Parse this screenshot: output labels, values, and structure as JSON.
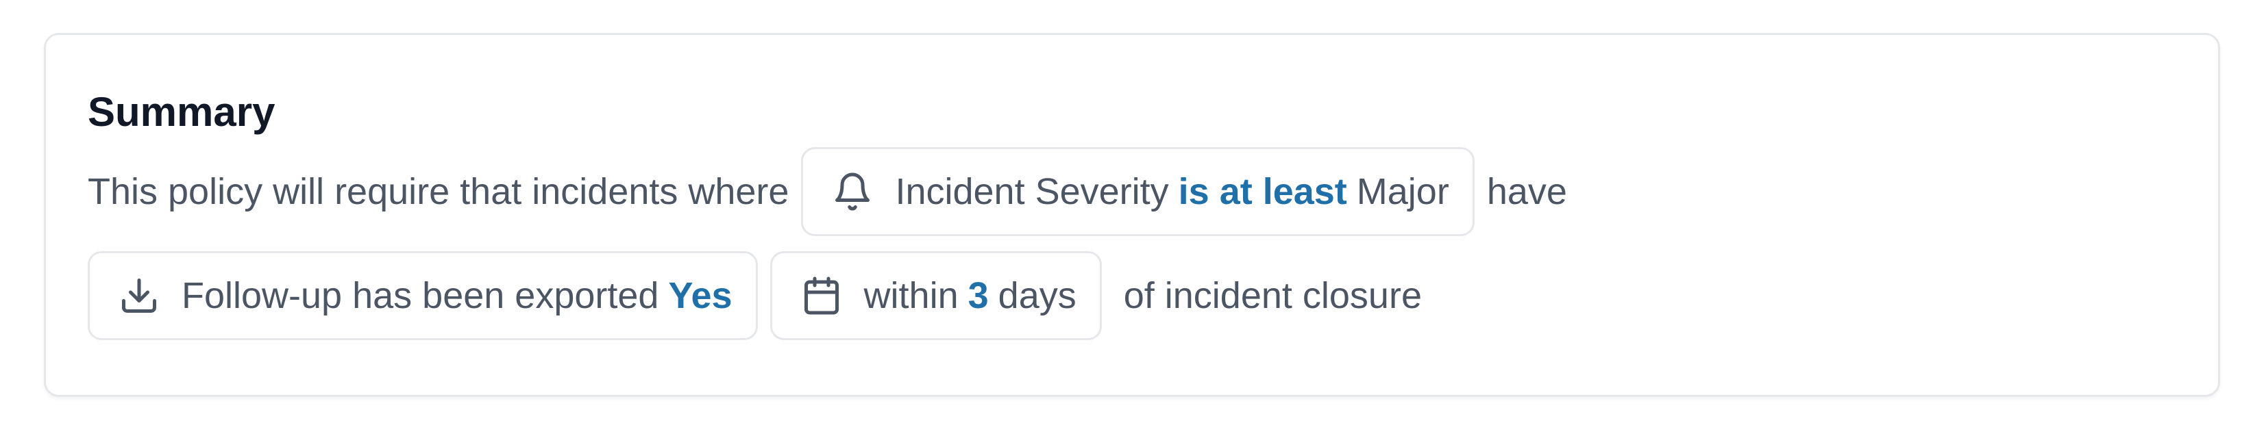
{
  "summary": {
    "title": "Summary",
    "intro": "This policy will require that incidents where",
    "condition": {
      "icon": "bell-icon",
      "field": "Incident Severity",
      "operator": "is at least",
      "value": "Major"
    },
    "verb": "have",
    "requirement": {
      "icon": "download-icon",
      "label": "Follow-up has been exported",
      "value": "Yes"
    },
    "deadline": {
      "icon": "calendar-icon",
      "prefix": "within",
      "amount": "3",
      "unit": "days"
    },
    "suffix": "of incident closure"
  },
  "colors": {
    "accent": "#1f6fa8",
    "text": "#4b5563",
    "title": "#111827",
    "border": "#e5e7eb"
  }
}
